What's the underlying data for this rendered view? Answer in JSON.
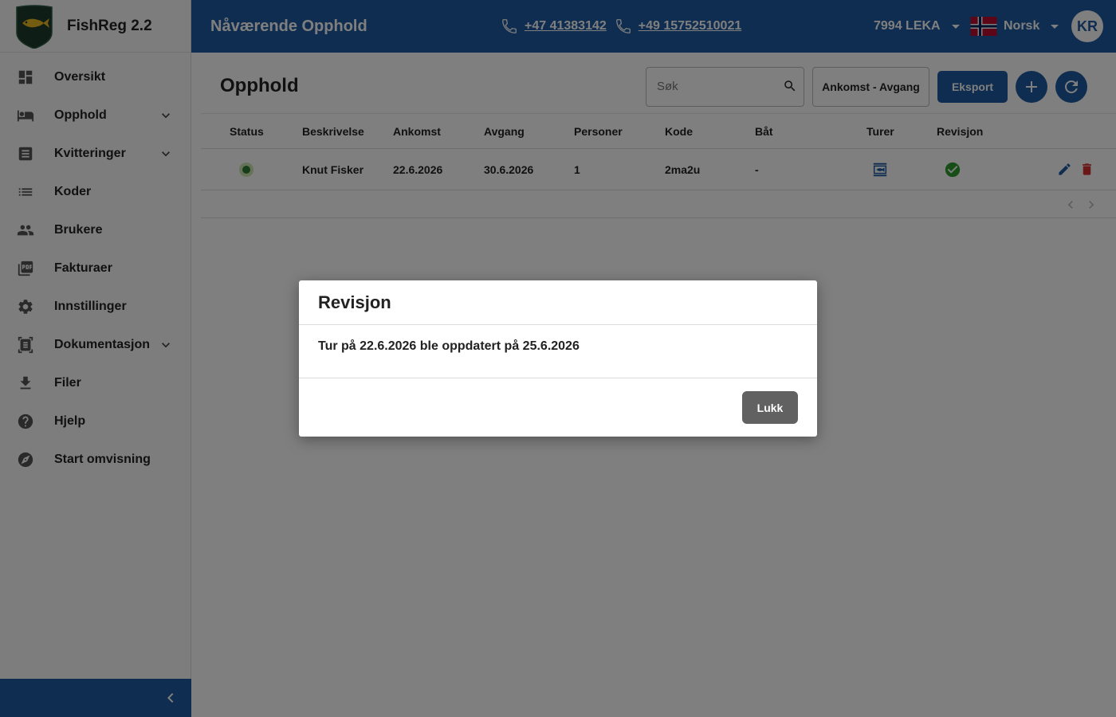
{
  "app": {
    "name": "FishReg 2.2"
  },
  "topbar": {
    "title": "Nåværende Opphold",
    "phones": [
      "+47 41383142",
      "+49 15752510021"
    ],
    "location": "7994 LEKA",
    "language": "Norsk",
    "user_initials": "KR"
  },
  "sidebar": {
    "items": [
      {
        "label": "Oversikt",
        "icon": "dashboard-icon"
      },
      {
        "label": "Opphold",
        "icon": "bed-icon",
        "expandable": true
      },
      {
        "label": "Kvitteringer",
        "icon": "receipt-icon",
        "expandable": true
      },
      {
        "label": "Koder",
        "icon": "list-icon"
      },
      {
        "label": "Brukere",
        "icon": "people-icon"
      },
      {
        "label": "Fakturaer",
        "icon": "pdf-icon"
      },
      {
        "label": "Innstillinger",
        "icon": "gear-icon"
      },
      {
        "label": "Dokumentasjon",
        "icon": "document-scan-icon",
        "expandable": true
      },
      {
        "label": "Filer",
        "icon": "download-icon"
      },
      {
        "label": "Hjelp",
        "icon": "help-icon"
      },
      {
        "label": "Start omvisning",
        "icon": "compass-icon"
      }
    ]
  },
  "main": {
    "title": "Opphold",
    "search_placeholder": "Søk",
    "range_label": "Ankomst - Avgang",
    "export_label": "Eksport"
  },
  "table": {
    "columns": [
      "Status",
      "Beskrivelse",
      "Ankomst",
      "Avgang",
      "Personer",
      "Kode",
      "Båt",
      "Turer",
      "Revisjon"
    ],
    "rows": [
      {
        "status": "active",
        "beskrivelse": "Knut Fisker",
        "ankomst": "22.6.2026",
        "avgang": "30.6.2026",
        "personer": "1",
        "kode": "2ma2u",
        "bat": "-",
        "turer_icon": "fishing-trip-icon",
        "revisjon_icon": "check-circle-icon"
      }
    ]
  },
  "modal": {
    "title": "Revisjon",
    "message": "Tur på 22.6.2026 ble oppdatert på 25.6.2026",
    "close_label": "Lukk"
  },
  "colors": {
    "primary": "#1f5aa0",
    "danger": "#d32f2f",
    "success": "#2e9b2e",
    "overlay": "rgba(0,0,0,0.5)"
  }
}
